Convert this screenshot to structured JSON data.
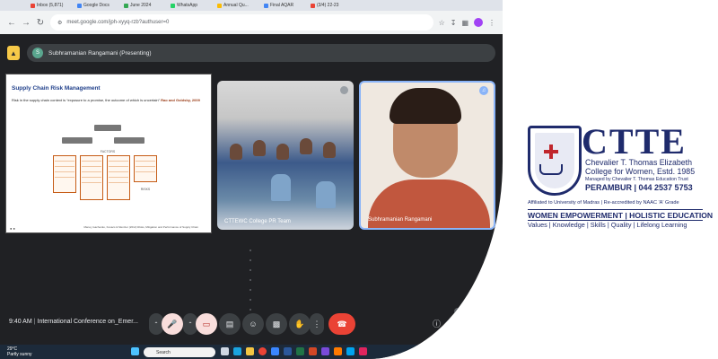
{
  "browser": {
    "tabs": [
      {
        "label": "Inbox (5,871)",
        "color": "#ea4335"
      },
      {
        "label": "Google Docs",
        "color": "#4285f4"
      },
      {
        "label": "June 2024",
        "color": "#34a853"
      },
      {
        "label": "WhatsApp",
        "color": "#25d366"
      },
      {
        "label": "Annual Qu...",
        "color": "#fbbc04"
      },
      {
        "label": "Final AQAR",
        "color": "#4285f4"
      },
      {
        "label": "(3/4) 22-23",
        "color": "#ea4335"
      }
    ],
    "url": "meet.google.com/jph-xyyq-rzb?authuser=0"
  },
  "meet": {
    "presenter": "Subhramanian Rangamani (Presenting)",
    "presenter_initial": "S",
    "slide": {
      "title": "Supply Chain Risk Management",
      "subtitle": "Risk in the supply chain context is “exposure to a promise, the outcome of which is uncertain”",
      "citation": "Rao and Goldsby, 2009",
      "factors_label": "FACTORS",
      "risk_label": "RISKS",
      "footer": "Manuj, Isachenko, Kovacs & Mentzer (2012) Risks, Mitigation and Performance of Supply Chain"
    },
    "tiles": [
      {
        "label": "CTTEWC College PR Team"
      },
      {
        "label": "Subhramanian Rangamani"
      }
    ],
    "time": "9:40 AM",
    "meeting_title": "International Conference on_Emer...",
    "participants_count": "16"
  },
  "taskbar": {
    "weather_temp": "29°C",
    "weather_desc": "Partly sunny",
    "search_placeholder": "Search",
    "lang": "ENG",
    "region": "IN"
  },
  "logo": {
    "acronym": "CTTE",
    "college_line1": "Chevalier T. Thomas Elizabeth",
    "college_line2": "College for Women, Estd. 1985",
    "managed_by": "Managed by Chevalier T. Thomas Education Trust",
    "location_phone": "PERAMBUR | 044 2537 5753",
    "affiliation": "Affiliated to University of Madras | Re-accredited by NAAC 'A' Grade",
    "tagline": "WOMEN EMPOWERMENT | HOLISTIC EDUCATION",
    "values": "Values | Knowledge | Skills | Quality | Lifelong Learning"
  },
  "colors": {
    "brand_navy": "#1f2b6c",
    "meet_dark": "#202124",
    "end_call_red": "#ea4335"
  }
}
